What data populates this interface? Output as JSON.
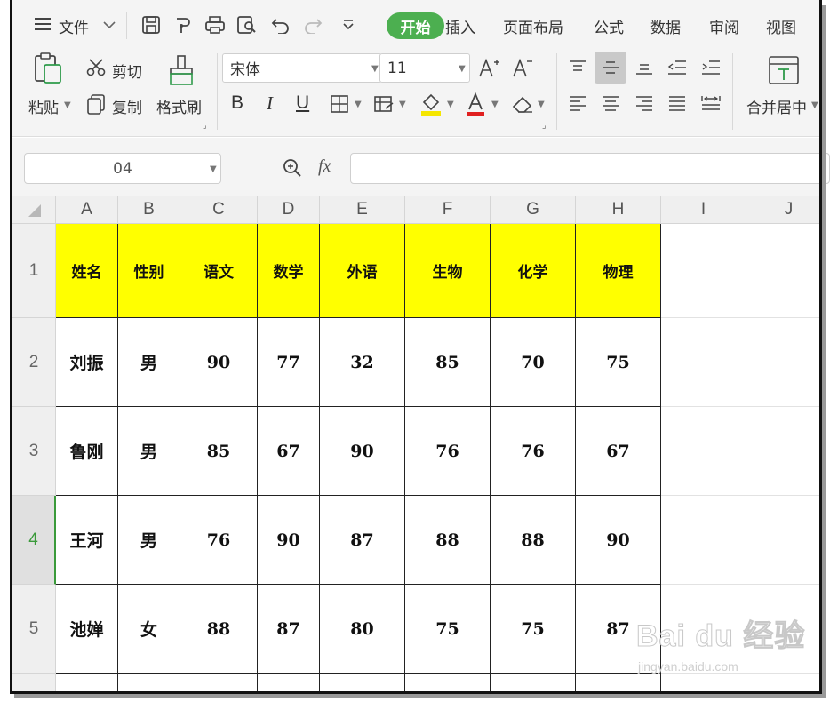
{
  "menubar": {
    "file_label": "文件",
    "tabs": [
      "开始",
      "插入",
      "页面布局",
      "公式",
      "数据",
      "审阅",
      "视图"
    ],
    "icons": [
      "hamburger-icon",
      "chevron-down-icon",
      "save-icon",
      "paint-icon",
      "print-icon",
      "print-preview-icon",
      "undo-icon",
      "redo-icon",
      "customize-icon"
    ]
  },
  "ribbon": {
    "paste": "粘贴",
    "cut": "剪切",
    "copy": "复制",
    "format_painter": "格式刷",
    "font_name": "宋体",
    "font_size": "11",
    "bold": "B",
    "italic": "I",
    "underline": "U",
    "merge_center": "合并居中"
  },
  "formula_bar": {
    "cell_ref": "04",
    "fx": "fx",
    "content": ""
  },
  "sheet": {
    "columns": [
      "A",
      "B",
      "C",
      "D",
      "E",
      "F",
      "G",
      "H",
      "I",
      "J"
    ],
    "row_numbers": [
      "1",
      "2",
      "3",
      "4",
      "5"
    ],
    "active_row": "4",
    "header_fill": "#ffff00",
    "accent": "#4caf50",
    "rows": [
      [
        "姓名",
        "性别",
        "语文",
        "数学",
        "外语",
        "生物",
        "化学",
        "物理"
      ],
      [
        "刘振",
        "男",
        "90",
        "77",
        "32",
        "85",
        "70",
        "75"
      ],
      [
        "鲁刚",
        "男",
        "85",
        "67",
        "90",
        "76",
        "76",
        "67"
      ],
      [
        "王河",
        "男",
        "76",
        "90",
        "87",
        "88",
        "88",
        "90"
      ],
      [
        "池婵",
        "女",
        "88",
        "87",
        "80",
        "75",
        "75",
        "87"
      ]
    ]
  },
  "watermark": {
    "brand": "Bai du 经验",
    "url": "jingyan.baidu.com"
  }
}
